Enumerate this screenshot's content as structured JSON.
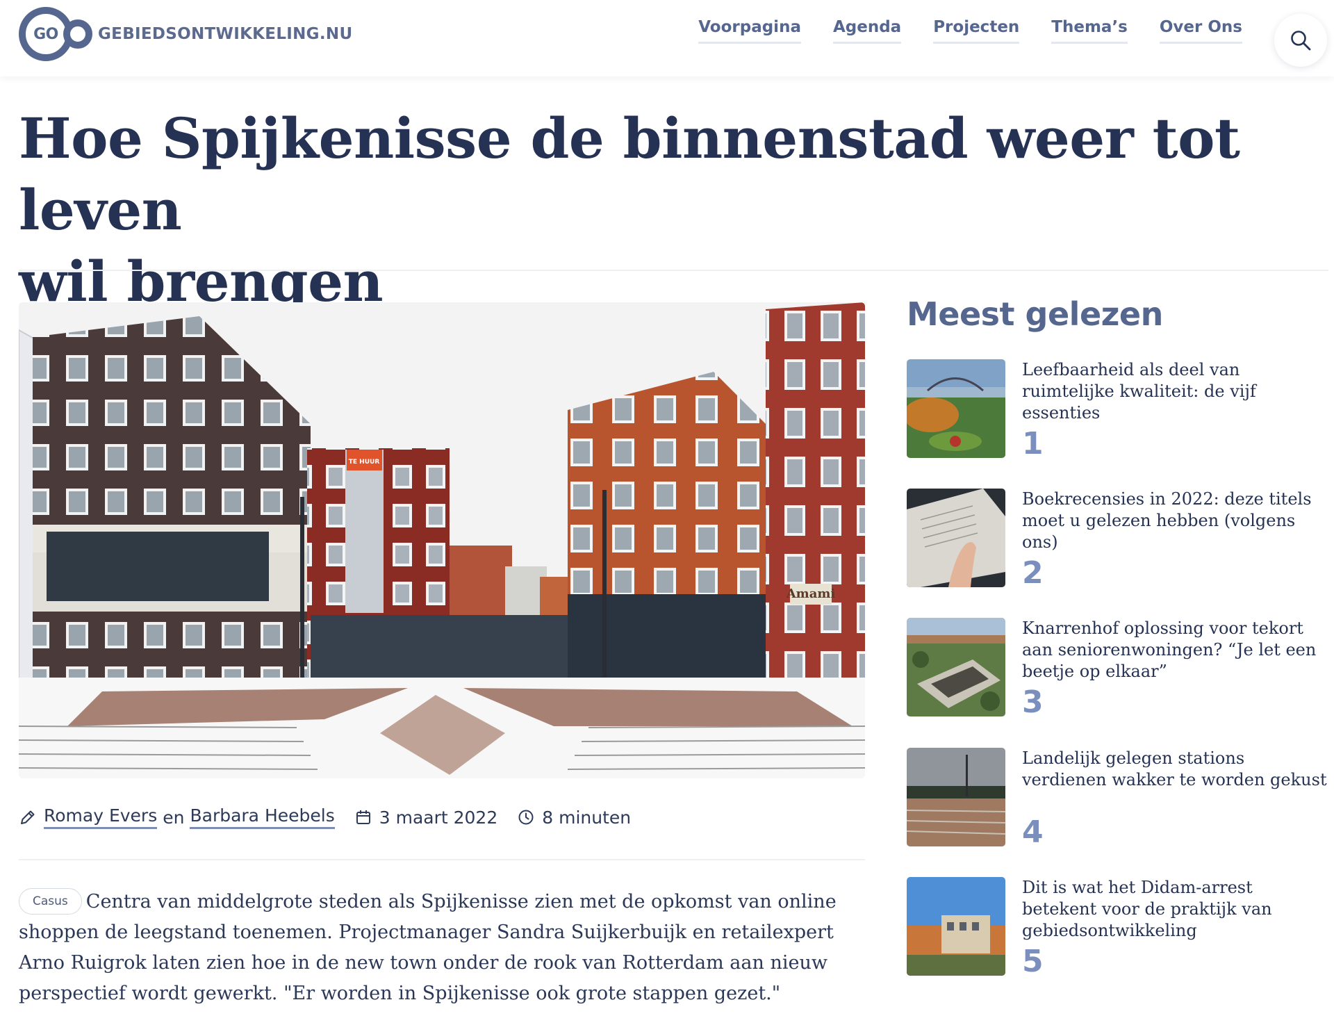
{
  "brand": {
    "logo_mark": "GO",
    "site_name": "GEBIEDSONTWIKKELING.NU",
    "accent": "#56678f",
    "title_color": "#253253"
  },
  "nav": {
    "items": [
      {
        "label": "Voorpagina"
      },
      {
        "label": "Agenda"
      },
      {
        "label": "Projecten"
      },
      {
        "label": "Thema’s"
      },
      {
        "label": "Over Ons"
      }
    ],
    "search_icon": "search-icon"
  },
  "article": {
    "title_line1": "Hoe Spijkenisse de binnenstad weer tot leven",
    "title_line2": "wil brengen",
    "authors": [
      "Romay Evers",
      "Barbara Heebels"
    ],
    "author_joiner": "en",
    "date": "3 maart 2022",
    "reading_time": "8 minuten",
    "tag": "Casus",
    "lead": "Centra van middelgrote steden als Spijkenisse zien met de opkomst van online shoppen de leegstand toenemen. Projectmanager Sandra Suijkerbuijk en retailexpert Arno Ruigrok laten zien hoe in de new town onder de rook van Rotterdam aan nieuw perspectief wordt gewerkt. \"Er worden in Spijkenisse ook grote stappen gezet.\"",
    "hero_banner_text": "TE HUUR",
    "hero_shop_sign": "Amami"
  },
  "sidebar": {
    "title": "Meest gelezen",
    "items": [
      {
        "rank": "1",
        "title": "Leefbaarheid als deel van ruimtelijke kwaliteit: de vijf essenties"
      },
      {
        "rank": "2",
        "title": "Boekrecensies in 2022: deze titels moet u gelezen hebben (volgens ons)"
      },
      {
        "rank": "3",
        "title": "Knarrenhof oplossing voor tekort aan seniorenwoningen? “Je let een beetje op elkaar”"
      },
      {
        "rank": "4",
        "title": "Landelijk gelegen stations verdienen wakker te worden gekust"
      },
      {
        "rank": "5",
        "title": "Dit is wat het Didam-arrest betekent voor de praktijk van gebiedsontwikkeling"
      }
    ]
  }
}
